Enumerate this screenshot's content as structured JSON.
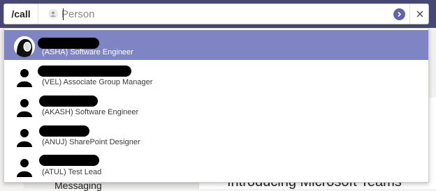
{
  "command": {
    "label": "/call",
    "placeholder": "Person",
    "value": ""
  },
  "icons": {
    "person": "person-icon",
    "submit": "chevron-right-icon",
    "close": "close-icon"
  },
  "results": [
    {
      "subtitle": "(ASHA) Software Engineer",
      "selected": true
    },
    {
      "subtitle": "(VEL) Associate Group Manager",
      "selected": false
    },
    {
      "subtitle": "(AKASH) Software Engineer",
      "selected": false
    },
    {
      "subtitle": "(ANUJ) SharePoint Designer",
      "selected": false
    },
    {
      "subtitle": "(ATUL) Test Lead",
      "selected": false
    }
  ],
  "background": {
    "left_text": "Messaging",
    "right_text": "Introducing Microsoft Teams"
  },
  "colors": {
    "accent": "#6264a7",
    "selected_row": "#7f85c4",
    "top_bar": "#464775"
  }
}
